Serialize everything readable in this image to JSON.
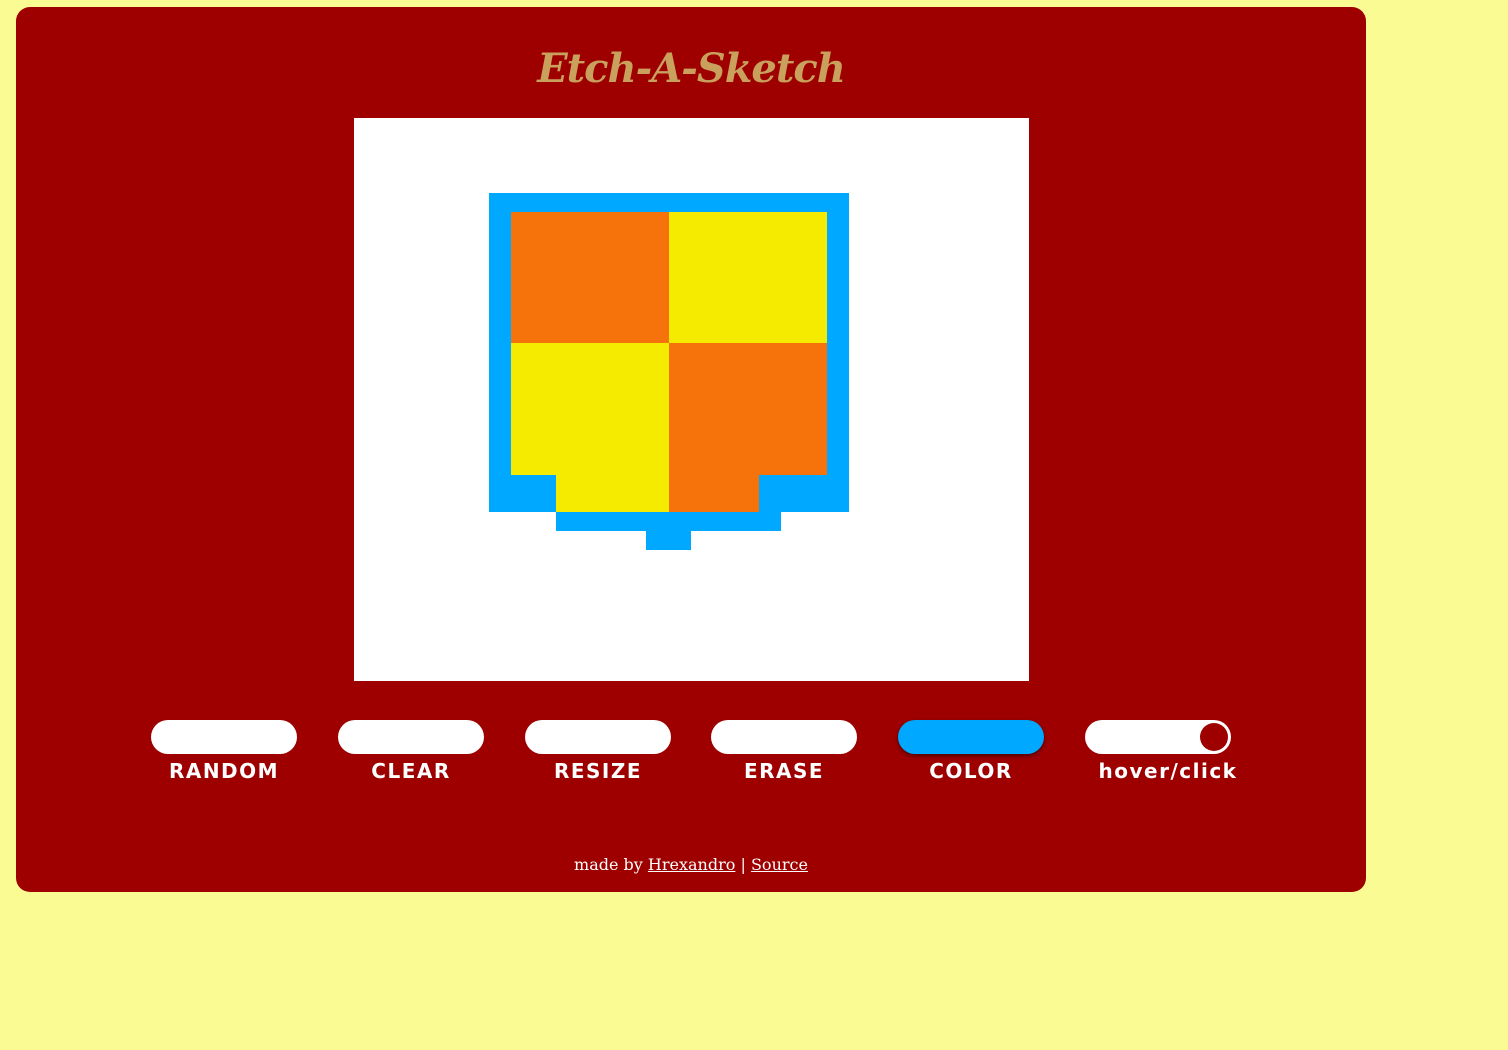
{
  "app": {
    "title": "Etch-A-Sketch"
  },
  "controls": [
    {
      "label": "RANDOM",
      "active": false
    },
    {
      "label": "CLEAR",
      "active": false
    },
    {
      "label": "RESIZE",
      "active": false
    },
    {
      "label": "ERASE",
      "active": false
    },
    {
      "label": "COLOR",
      "active": true
    },
    {
      "label": "hover/click",
      "toggle": true
    }
  ],
  "footer": {
    "prefix": "made by",
    "author_link": "Hrexandro",
    "separator": "|",
    "source_link": "Source"
  },
  "colors": {
    "page_background": "#fbfb94",
    "panel": "#9e0000",
    "title": "#c9a05c",
    "canvas": "#ffffff",
    "selected_color": "#00a8ff",
    "drawing_outline": "#00a8ff",
    "drawing_orange": "#f5730a",
    "drawing_yellow": "#f4eb00"
  }
}
